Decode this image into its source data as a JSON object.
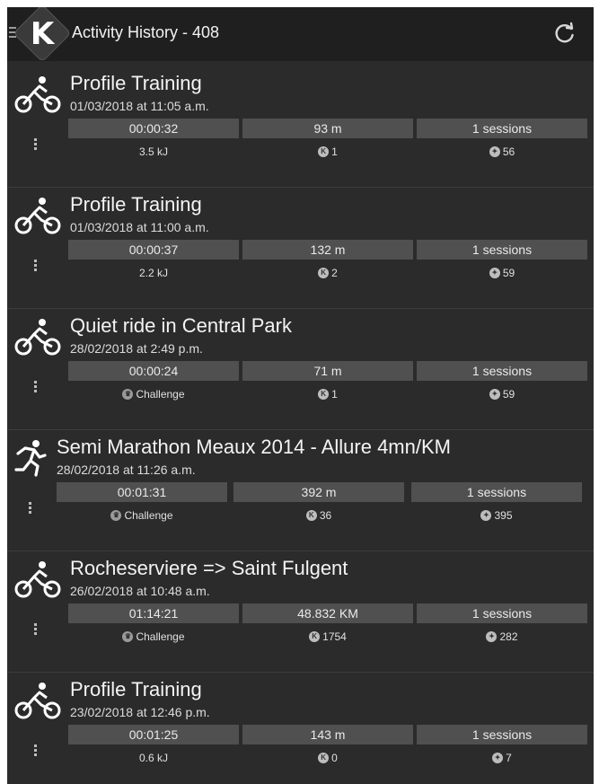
{
  "app": {
    "title": "Activity History - 408"
  },
  "entries": [
    {
      "title": "Profile Training",
      "date": "01/03/2018 at 11:05 a.m.",
      "duration": "00:00:32",
      "distance": "93 m",
      "sessions": "1 sessions",
      "extra": "3.5 kJ",
      "stat_a": "1",
      "stat_b": "56",
      "kind": "bike"
    },
    {
      "title": "Profile Training",
      "date": "01/03/2018 at 11:00 a.m.",
      "duration": "00:00:37",
      "distance": "132 m",
      "sessions": "1 sessions",
      "extra": "2.2 kJ",
      "stat_a": "2",
      "stat_b": "59",
      "kind": "bike"
    },
    {
      "title": "Quiet ride in Central Park",
      "date": "28/02/2018 at 2:49 p.m.",
      "duration": "00:00:24",
      "distance": "71 m",
      "sessions": "1 sessions",
      "extra": "Challenge",
      "stat_a": "1",
      "stat_b": "59",
      "kind": "bike"
    },
    {
      "title": "Semi Marathon Meaux 2014 - Allure 4mn/KM",
      "date": "28/02/2018 at 11:26 a.m.",
      "duration": "00:01:31",
      "distance": "392 m",
      "sessions": "1 sessions",
      "extra": "Challenge",
      "stat_a": "36",
      "stat_b": "395",
      "kind": "run"
    },
    {
      "title": "Rocheserviere => Saint Fulgent",
      "date": "26/02/2018 at 10:48 a.m.",
      "duration": "01:14:21",
      "distance": "48.832 KM",
      "sessions": "1 sessions",
      "extra": "Challenge",
      "stat_a": "1754",
      "stat_b": "282",
      "kind": "bike"
    },
    {
      "title": "Profile Training",
      "date": "23/02/2018 at 12:46 p.m.",
      "duration": "00:01:25",
      "distance": "143 m",
      "sessions": "1 sessions",
      "extra": "0.6 kJ",
      "stat_a": "0",
      "stat_b": "7",
      "kind": "bike"
    }
  ],
  "icons": {
    "menu": "hamburger-icon",
    "logo": "k-logo",
    "refresh": "refresh-icon",
    "bike": "cyclist-icon",
    "run": "runner-icon",
    "more": "more-vert-icon",
    "challenge": "trophy-icon",
    "stat_a": "k-badge-icon",
    "stat_b": "medal-icon"
  }
}
